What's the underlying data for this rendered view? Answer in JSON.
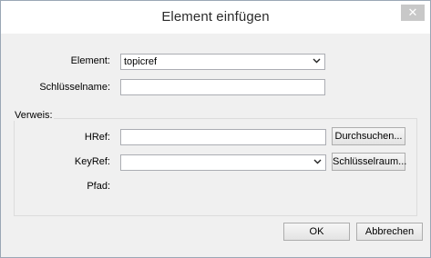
{
  "dialog": {
    "title": "Element einfügen",
    "close_glyph": "✕"
  },
  "form": {
    "element_label": "Element:",
    "element_value": "topicref",
    "key_name_label": "Schlüsselname:",
    "key_name_value": "",
    "reference_group_label": "Verweis:",
    "href_label": "HRef:",
    "href_value": "",
    "browse_button": "Durchsuchen...",
    "keyref_label": "KeyRef:",
    "keyref_value": "",
    "keyspace_button": "Schlüsselraum...",
    "path_label": "Pfad:",
    "path_value": ""
  },
  "footer": {
    "ok_button": "OK",
    "cancel_button": "Abbrechen"
  },
  "icons": {
    "dropdown": "chevron-down-icon",
    "close": "close-icon"
  }
}
